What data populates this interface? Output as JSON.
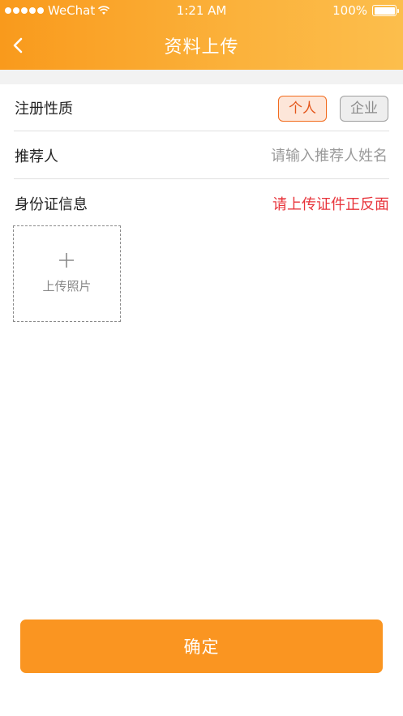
{
  "status_bar": {
    "carrier": "WeChat",
    "time": "1:21 AM",
    "battery": "100%"
  },
  "nav": {
    "title": "资料上传",
    "back_icon": "chevron-left-icon"
  },
  "form": {
    "registration_type": {
      "label": "注册性质",
      "options": [
        "个人",
        "企业"
      ],
      "selected": "个人"
    },
    "referrer": {
      "label": "推荐人",
      "value": "",
      "placeholder": "请输入推荐人姓名"
    },
    "id_info": {
      "label": "身份证信息",
      "hint": "请上传证件正反面"
    },
    "upload": {
      "label": "上传照片",
      "icon": "plus-icon"
    }
  },
  "confirm_button": "确定",
  "colors": {
    "header_gradient_start": "#f99a1c",
    "header_gradient_end": "#fcbe4c",
    "accent": "#fa9521",
    "selected_border": "#f26b1d",
    "hint_red": "#e8343b"
  }
}
